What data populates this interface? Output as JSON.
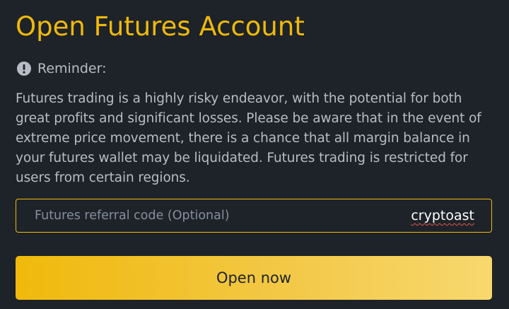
{
  "title": "Open Futures Account",
  "reminder": {
    "icon": "exclamation-circle-icon",
    "label": "Reminder:"
  },
  "body_text": "Futures trading is a highly risky endeavor, with the potential for both great profits and significant losses. Please be aware that in the event of extreme price movement, there is a chance that all margin balance in your futures wallet may be liquidated. Futures trading is restricted for users from certain regions.",
  "referral": {
    "label": "Futures referral code (Optional)",
    "value": "cryptoast"
  },
  "open_button": {
    "label": "Open now"
  },
  "colors": {
    "background": "#1e2329",
    "accent": "#f0b90b",
    "text_secondary": "#b7bdc6"
  }
}
